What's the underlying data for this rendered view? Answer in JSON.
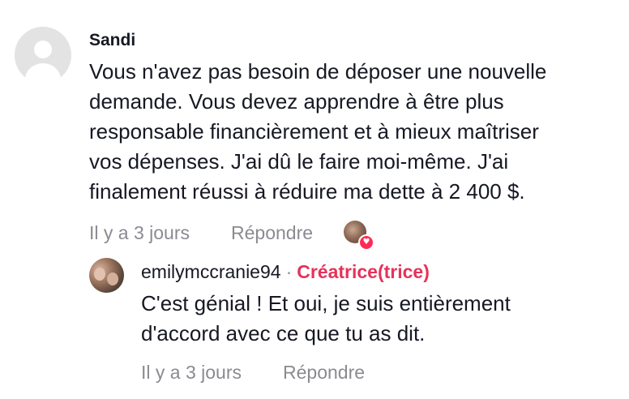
{
  "comment": {
    "author": "Sandi",
    "lines": [
      "Vous n'avez pas besoin de déposer une nouvelle",
      "demande. Vous devez apprendre à être plus",
      "responsable financièrement et à mieux maîtriser",
      "vos dépenses. J'ai dû le faire moi-même. J'ai",
      "finalement réussi à réduire ma dette à 2 400 $."
    ],
    "time": "Il y a 3 jours",
    "reply_label": "Répondre",
    "avatar_icon": "default-user-icon",
    "liked_by_creator_icon": "heart-icon"
  },
  "reply": {
    "author": "emilymccranie94",
    "separator": "·",
    "badge": "Créatrice(trice)",
    "lines": [
      "C'est génial ! Et oui, je suis entièrement",
      "d'accord avec ce que tu as dit."
    ],
    "time": "Il y a 3 jours",
    "reply_label": "Répondre"
  },
  "colors": {
    "text": "#161823",
    "secondary": "#8a8b91",
    "creator_badge": "#e6325a",
    "heart": "#fe2c55"
  }
}
